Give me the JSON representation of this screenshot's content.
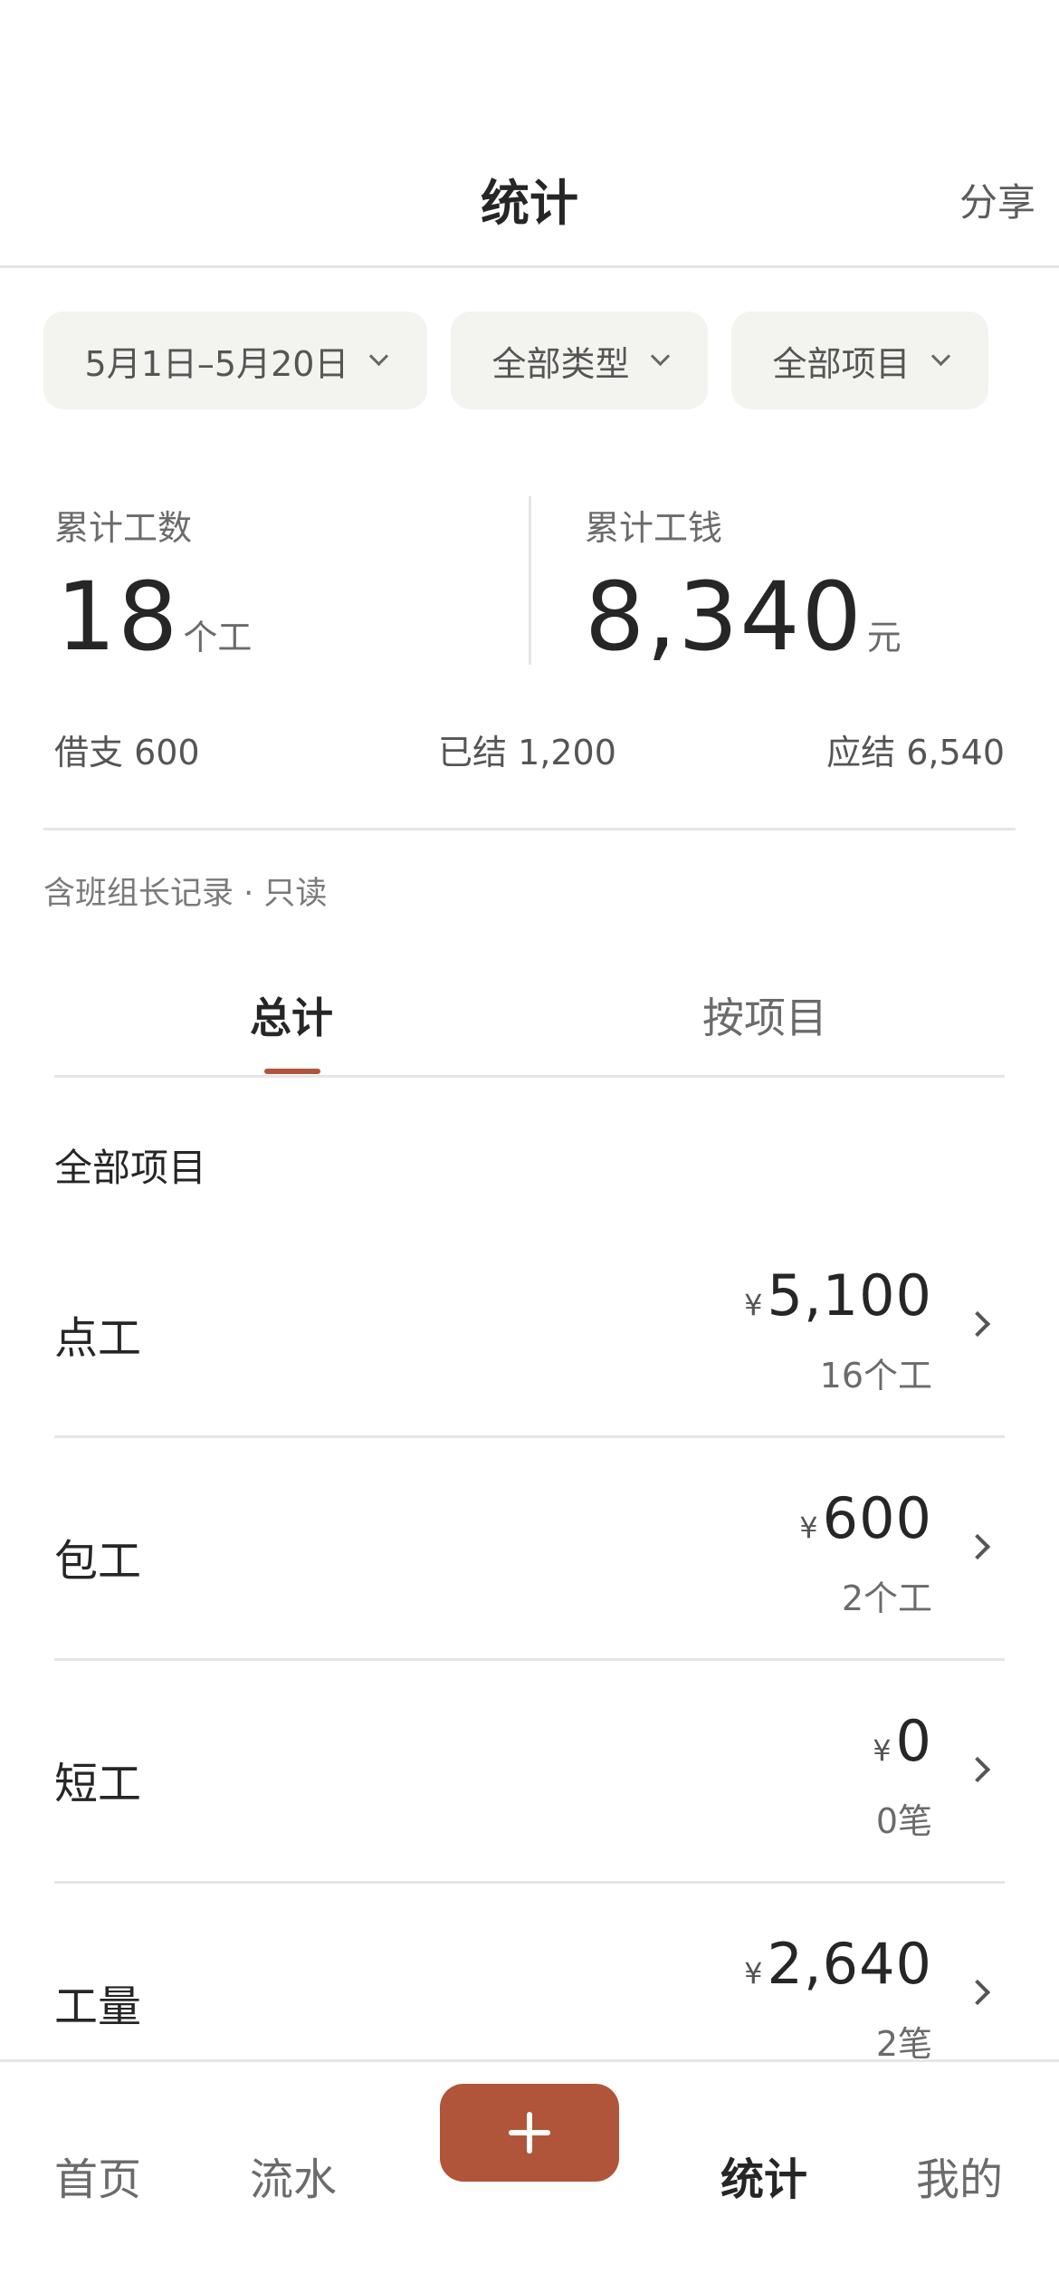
{
  "header": {
    "title": "统计",
    "share_label": "分享"
  },
  "filters": [
    {
      "label": "5月1日–5月20日"
    },
    {
      "label": "全部类型"
    },
    {
      "label": "全部项目"
    }
  ],
  "summary": {
    "days_label": "累计工数",
    "days_value": "18",
    "days_unit": "个工",
    "money_label": "累计工钱",
    "money_value": "8,340",
    "money_unit": "元",
    "borrowed": "借支 600",
    "settled": "已结 1,200",
    "due": "应结 6,540"
  },
  "note": "含班组长记录 · 只读",
  "tabs": [
    {
      "label": "总计",
      "active": true
    },
    {
      "label": "按项目",
      "active": false
    }
  ],
  "section_title": "全部项目",
  "currency_symbol": "¥",
  "rows": [
    {
      "label": "点工",
      "amount": "5,100",
      "sub": "16个工"
    },
    {
      "label": "包工",
      "amount": "600",
      "sub": "2个工"
    },
    {
      "label": "短工",
      "amount": "0",
      "sub": "0笔"
    },
    {
      "label": "工量",
      "amount": "2,640",
      "sub": "2笔"
    }
  ],
  "tabbar": {
    "home": "首页",
    "flow": "流水",
    "stats": "统计",
    "mine": "我的",
    "active": "stats"
  },
  "colors": {
    "accent": "#b0553a",
    "chip_bg": "#f3f3ef",
    "divider": "#e6e6e4"
  }
}
